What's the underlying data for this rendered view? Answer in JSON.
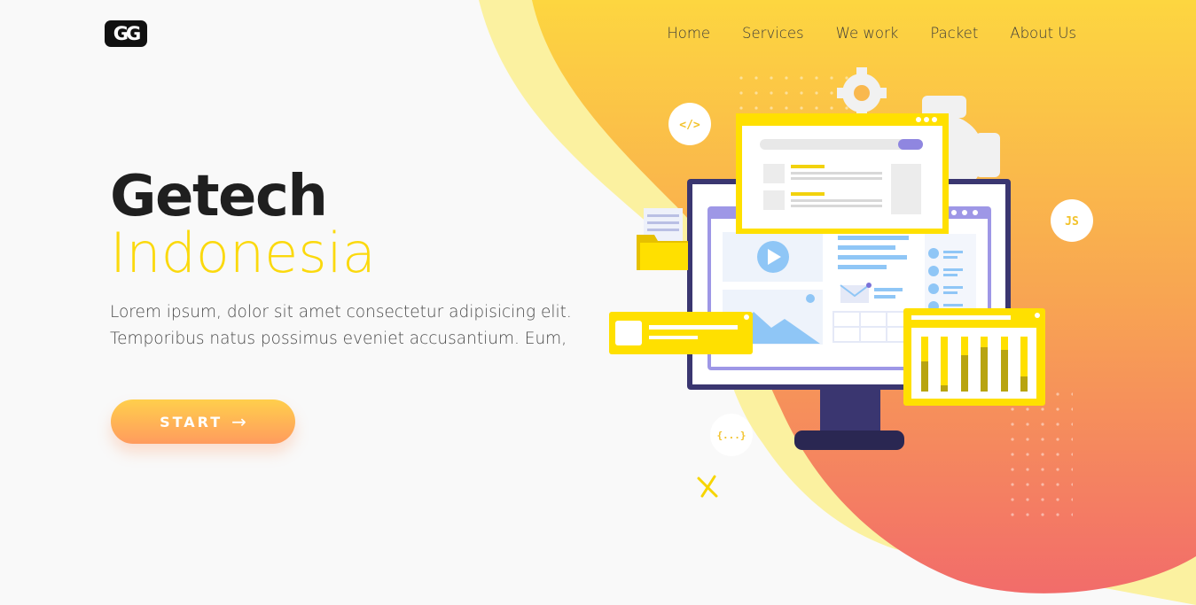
{
  "brand": {
    "logo_text": "GG"
  },
  "nav": {
    "items": [
      {
        "label": "Home"
      },
      {
        "label": "Services"
      },
      {
        "label": "We work"
      },
      {
        "label": "Packet"
      },
      {
        "label": "About Us"
      }
    ]
  },
  "hero": {
    "title_line1": "Getech",
    "title_line2": "Indonesia",
    "description": "Lorem ipsum, dolor sit amet consectetur adipisicing elit. Temporibus natus possimus eveniet accusantium. Eum,",
    "cta_label": "START",
    "cta_icon": "arrow-right-icon"
  },
  "illustration": {
    "badges": {
      "code": "</>",
      "js": "JS",
      "braces": "{...}"
    },
    "icons": [
      "gear-icon",
      "play-icon",
      "folder-icon",
      "mail-icon",
      "bar-chart-icon",
      "close-icon"
    ]
  },
  "colors": {
    "accent_yellow": "#fbd90d",
    "gradient_top": "#fdd343",
    "gradient_bottom": "#f26c6a",
    "monitor_frame": "#3a3670"
  }
}
